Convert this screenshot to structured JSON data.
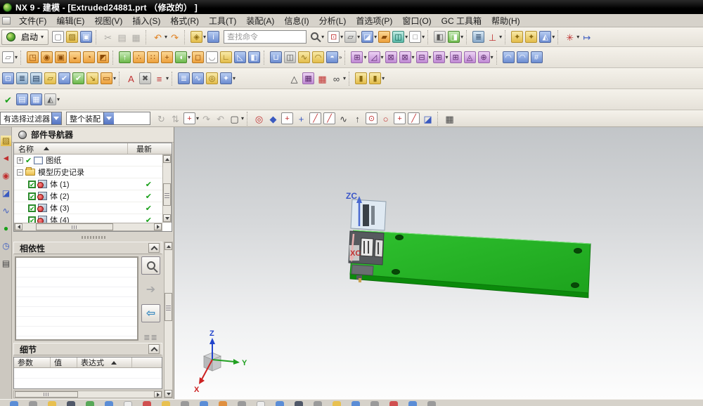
{
  "window": {
    "title": "NX 9 - 建模 - [Extruded24881.prt （修改的） ]"
  },
  "menu": {
    "items": [
      {
        "label": "文件(F)"
      },
      {
        "label": "编辑(E)"
      },
      {
        "label": "视图(V)"
      },
      {
        "label": "插入(S)"
      },
      {
        "label": "格式(R)"
      },
      {
        "label": "工具(T)"
      },
      {
        "label": "装配(A)"
      },
      {
        "label": "信息(I)"
      },
      {
        "label": "分析(L)"
      },
      {
        "label": "首选项(P)"
      },
      {
        "label": "窗口(O)"
      },
      {
        "label": "GC 工具箱"
      },
      {
        "label": "帮助(H)"
      }
    ]
  },
  "toolbars": {
    "launch_label": "启动",
    "launch_dd": "▾",
    "find_placeholder": "查找命令",
    "find_dd": "▾",
    "row1a": [
      {
        "n": "new-file-icon",
        "g": "▢",
        "cls": "c-white"
      },
      {
        "n": "open-file-icon",
        "g": "▨",
        "cls": "c-gold"
      },
      {
        "n": "save-icon",
        "g": "▣",
        "cls": "c-blue"
      },
      {
        "n": "separator",
        "cls": "tsep",
        "ia": "false"
      },
      {
        "n": "cut-icon",
        "g": "✂",
        "cls": "c-plain dim"
      },
      {
        "n": "copy-icon",
        "g": "▤",
        "cls": "c-plain dim"
      },
      {
        "n": "paste-icon",
        "g": "▦",
        "cls": "c-plain dim"
      },
      {
        "n": "separator",
        "cls": "tsep",
        "ia": "false"
      },
      {
        "n": "undo-icon",
        "g": "↶",
        "cls": "c-plain c-or-tx",
        "dd": "▾"
      },
      {
        "n": "redo-icon",
        "g": "↷",
        "cls": "c-plain c-or-tx"
      },
      {
        "n": "separator",
        "cls": "tsep",
        "ia": "false"
      },
      {
        "n": "command-key-icon",
        "g": "◈",
        "cls": "c-gold",
        "dd": "▾"
      },
      {
        "n": "info-tag-icon",
        "g": "i",
        "cls": "c-blue"
      }
    ],
    "row1b": [
      {
        "n": "fit-view-icon",
        "g": "⊡",
        "cls": "boxed c-bluetx",
        "dd": "▾"
      },
      {
        "n": "display-mode-icon",
        "g": "▱",
        "cls": "c-gray",
        "dd": "▾"
      },
      {
        "n": "shaded-view-icon",
        "g": "◪",
        "cls": "c-blue",
        "dd": "▾"
      },
      {
        "n": "render-style-icon",
        "g": "▰",
        "cls": "c-orange"
      },
      {
        "n": "translucency-icon",
        "g": "◫",
        "cls": "c-teal",
        "dd": "▾"
      },
      {
        "n": "background-icon",
        "g": "□",
        "cls": "c-white",
        "dd": "▾"
      },
      {
        "n": "separator",
        "cls": "tsep",
        "ia": "false"
      },
      {
        "n": "window-prev-icon",
        "g": "◧",
        "cls": "c-gray"
      },
      {
        "n": "window-next-icon",
        "g": "◨",
        "cls": "c-green2",
        "dd": "▾"
      },
      {
        "n": "separator",
        "cls": "tsep",
        "ia": "false"
      },
      {
        "n": "operation-list-icon",
        "g": "≣",
        "cls": "c-teal2"
      },
      {
        "n": "csys-orient-icon",
        "g": "⊥",
        "cls": "c-plain c-redax",
        "dd": "▾"
      },
      {
        "n": "separator",
        "cls": "tsep",
        "ia": "false"
      },
      {
        "n": "unlock-icon",
        "g": "✦",
        "cls": "c-gold"
      },
      {
        "n": "keys-icon",
        "g": "✦",
        "cls": "c-gold"
      },
      {
        "n": "visibility-toggle-icon",
        "g": "◭",
        "cls": "c-blue",
        "dd": "▾"
      },
      {
        "n": "separator",
        "cls": "tsep",
        "ia": "false"
      },
      {
        "n": "pins-icon",
        "g": "✳",
        "cls": "c-plain c-redax",
        "dd": "▾"
      },
      {
        "n": "measure-distance-icon",
        "g": "↦",
        "cls": "c-plain c-bluetx"
      }
    ],
    "row2": [
      {
        "n": "sketch-icon",
        "g": "▱",
        "cls": "c-white",
        "dd": "▾"
      },
      {
        "n": "separator",
        "cls": "tsep",
        "ia": "false"
      },
      {
        "n": "extrude-icon",
        "g": "◳",
        "cls": "c-orange"
      },
      {
        "n": "revolve-icon",
        "g": "◉",
        "cls": "c-orange"
      },
      {
        "n": "hole-icon",
        "g": "▣",
        "cls": "c-orange"
      },
      {
        "n": "boss-icon",
        "g": "◒",
        "cls": "c-orange"
      },
      {
        "n": "pocket-icon",
        "g": "◔",
        "cls": "c-orange"
      },
      {
        "n": "emboss-icon",
        "g": "◩",
        "cls": "c-orange"
      },
      {
        "n": "separator",
        "cls": "tsep",
        "ia": "false"
      },
      {
        "n": "datum-plane-icon",
        "g": "↑",
        "cls": "c-green2"
      },
      {
        "n": "cluster-icon",
        "g": "∴",
        "cls": "c-orange"
      },
      {
        "n": "pattern-feature-icon",
        "g": "∷",
        "cls": "c-orange"
      },
      {
        "n": "unite-icon",
        "g": "+",
        "cls": "c-orange"
      },
      {
        "n": "boolean-icon",
        "g": "◖",
        "cls": "c-green2",
        "dd": "▾"
      },
      {
        "n": "block-icon",
        "g": "◻",
        "cls": "c-orange"
      },
      {
        "n": "shell-icon",
        "g": "◡",
        "cls": "c-white"
      },
      {
        "n": "bracket-icon",
        "g": "∟",
        "cls": "c-gold"
      },
      {
        "n": "draft-icon",
        "g": "◺",
        "cls": "c-blue"
      },
      {
        "n": "chamfer-icon",
        "g": "◧",
        "cls": "c-blue"
      },
      {
        "n": "separator",
        "cls": "tsep",
        "ia": "false"
      },
      {
        "n": "blend-icon",
        "g": "⊔",
        "cls": "c-blue"
      },
      {
        "n": "trim-body-icon",
        "g": "◫",
        "cls": "c-gray"
      },
      {
        "n": "sheet-icon",
        "g": "∿",
        "cls": "c-gold"
      },
      {
        "n": "sweep-icon",
        "g": "◠",
        "cls": "c-gold"
      },
      {
        "n": "more-features-icon",
        "g": "◓",
        "cls": "c-blue",
        "dd": "»"
      },
      {
        "n": "separator",
        "cls": "tsep",
        "ia": "false"
      },
      {
        "n": "move-face-icon",
        "g": "⊞",
        "cls": "c-purple",
        "dd": "▾"
      },
      {
        "n": "delete-face-icon",
        "g": "◿",
        "cls": "c-purple",
        "dd": "▾"
      },
      {
        "n": "replace-face-icon",
        "g": "⊠",
        "cls": "c-purple"
      },
      {
        "n": "resize-face-icon",
        "g": "⊠",
        "cls": "c-purple",
        "dd": "▾"
      },
      {
        "n": "linear-dimension-icon",
        "g": "⊟",
        "cls": "c-purple",
        "dd": "▾"
      },
      {
        "n": "offset-face-icon",
        "g": "⊞",
        "cls": "c-purple",
        "dd": "▾"
      },
      {
        "n": "pattern-face-icon",
        "g": "⊞",
        "cls": "c-purple"
      },
      {
        "n": "make-coplanar-icon",
        "g": "◬",
        "cls": "c-purple"
      },
      {
        "n": "sync-modeling-icon",
        "g": "⊕",
        "cls": "c-purple",
        "dd": "▾"
      },
      {
        "n": "separator",
        "cls": "tsep",
        "ia": "false"
      },
      {
        "n": "four-point-surface-icon",
        "g": "◠",
        "cls": "c-blue"
      },
      {
        "n": "swept-surface-icon",
        "g": "◠",
        "cls": "c-blue"
      },
      {
        "n": "mesh-surface-icon",
        "g": "#",
        "cls": "c-blue"
      }
    ],
    "row3": [
      {
        "n": "view-frame-icon",
        "g": "⊡",
        "cls": "c-blue"
      },
      {
        "n": "layer-stack-icon",
        "g": "≣",
        "cls": "c-teal2"
      },
      {
        "n": "layer-settings-icon",
        "g": "▤",
        "cls": "c-teal2"
      },
      {
        "n": "tag-icon",
        "g": "▱",
        "cls": "c-gold"
      },
      {
        "n": "examine-geometry-icon",
        "g": "✔",
        "cls": "c-blue"
      },
      {
        "n": "fix-model-icon",
        "g": "✔",
        "cls": "c-green2"
      },
      {
        "n": "export-icon",
        "g": "↘",
        "cls": "c-gold"
      },
      {
        "n": "expression-icon",
        "g": "▭",
        "cls": "c-orange",
        "dd": "▾"
      },
      {
        "n": "separator",
        "cls": "tsep",
        "ia": "false"
      },
      {
        "n": "annotation-icon",
        "g": "A",
        "cls": "c-plain c-redax"
      },
      {
        "n": "mouse-gesture-icon",
        "g": "✖",
        "cls": "c-gray"
      },
      {
        "n": "ruler-hand-icon",
        "g": "≡",
        "cls": "c-plain c-redax",
        "dd": "▾"
      },
      {
        "n": "separator",
        "cls": "tsep",
        "ia": "false"
      },
      {
        "n": "database-icon",
        "g": "≣",
        "cls": "c-blue"
      },
      {
        "n": "spring-icon",
        "g": "∿",
        "cls": "c-blue"
      },
      {
        "n": "torus-icon",
        "g": "◎",
        "cls": "c-gold"
      },
      {
        "n": "hand-tool-icon",
        "g": "✦",
        "cls": "c-blue",
        "dd": "▾"
      },
      {
        "n": "spacer",
        "cls": "tspace",
        "ia": "false"
      },
      {
        "n": "triangle-icon",
        "g": "△",
        "cls": "c-plain"
      },
      {
        "n": "spreadsheet-icon",
        "g": "▦",
        "cls": "c-purple"
      },
      {
        "n": "table-add-icon",
        "g": "▦",
        "cls": "c-plain c-redax"
      },
      {
        "n": "circles-icon",
        "g": "∞",
        "cls": "c-plain",
        "dd": "▾"
      },
      {
        "n": "separator",
        "cls": "tsep",
        "ia": "false"
      },
      {
        "n": "assembly-box-icon",
        "g": "▮",
        "cls": "c-gold"
      },
      {
        "n": "assembly-boxes-icon",
        "g": "▮",
        "cls": "c-gold",
        "dd": "▾"
      }
    ],
    "row4": [
      {
        "n": "check-mate-icon",
        "g": "✔",
        "cls": "c-plain c-greentx"
      },
      {
        "n": "clipboard-icon",
        "g": "▤",
        "cls": "c-blue"
      },
      {
        "n": "table-icon",
        "g": "▦",
        "cls": "c-blue"
      },
      {
        "n": "view-section-icon",
        "g": "◭",
        "cls": "c-gray",
        "dd": "▾"
      }
    ]
  },
  "selection_bar": {
    "filter_value": "有选择过滤器",
    "scope_value": "整个装配",
    "icons": [
      {
        "n": "cycle-select-icon",
        "g": "↻",
        "cls": "c-plain dim"
      },
      {
        "n": "swap-select-icon",
        "g": "⇅",
        "cls": "c-plain dim"
      },
      {
        "n": "add-filter-icon",
        "g": "+",
        "cls": "boxed c-or-tx",
        "dd": "▾"
      },
      {
        "n": "rotate-cw-icon",
        "g": "↷",
        "cls": "c-plain dim"
      },
      {
        "n": "rotate-ccw-icon",
        "g": "↶",
        "cls": "c-plain dim"
      },
      {
        "n": "marquee-icon",
        "g": "▢",
        "cls": "c-plain",
        "dd": "▾"
      },
      {
        "n": "separator",
        "cls": "tsep",
        "ia": "false"
      },
      {
        "n": "highlight-icon",
        "g": "◎",
        "cls": "c-plain c-redax"
      },
      {
        "n": "shaded-select-icon",
        "g": "◆",
        "cls": "c-plain c-bluetx"
      },
      {
        "n": "snap-all-icon",
        "g": "+",
        "cls": "boxed c-or-tx"
      },
      {
        "n": "snap-point-icon",
        "g": "+",
        "cls": "c-plain c-bluetx"
      },
      {
        "n": "endpoint-snap-icon",
        "g": "╱",
        "cls": "boxed"
      },
      {
        "n": "midpoint-snap-icon",
        "g": "╱",
        "cls": "boxed"
      },
      {
        "n": "curve-snap-icon",
        "g": "∿",
        "cls": "c-plain"
      },
      {
        "n": "vertex-snap-icon",
        "g": "↑",
        "cls": "c-plain"
      },
      {
        "n": "center-snap-icon",
        "g": "⊙",
        "cls": "boxed"
      },
      {
        "n": "quadrant-snap-icon",
        "g": "○",
        "cls": "c-plain c-redax"
      },
      {
        "n": "intersection-snap-icon",
        "g": "+",
        "cls": "boxed"
      },
      {
        "n": "point-on-curve-icon",
        "g": "╱",
        "cls": "boxed"
      },
      {
        "n": "face-snap-icon",
        "g": "◪",
        "cls": "c-plain c-bluetx"
      },
      {
        "n": "separator",
        "cls": "tsep",
        "ia": "false"
      },
      {
        "n": "grid-snap-icon",
        "g": "▦",
        "cls": "c-plain"
      }
    ]
  },
  "resource_bar": {
    "tabs": [
      {
        "n": "assembly-navigator-icon",
        "g": "▨",
        "cls": "c-gold"
      },
      {
        "n": "constraint-navigator-icon",
        "g": "◄",
        "cls": "c-redax"
      },
      {
        "n": "part-navigator-icon",
        "g": "◉",
        "cls": "c-redax"
      },
      {
        "n": "reuse-library-icon",
        "g": "◪",
        "cls": "c-bluetx"
      },
      {
        "n": "hd3d-tools-icon",
        "g": "∿",
        "cls": "c-bluetx"
      },
      {
        "n": "web-browser-icon",
        "g": "●",
        "cls": "c-greentx"
      },
      {
        "n": "history-icon",
        "g": "◷",
        "cls": "c-bluetx"
      },
      {
        "n": "palettes-icon",
        "g": "▤",
        "cls": "c-plain"
      }
    ]
  },
  "part_navigator": {
    "title": "部件导航器",
    "col_name": "名称",
    "col_latest": "最新",
    "rows": [
      {
        "exp": "plus",
        "lead": "checkmark",
        "ic": "drawing",
        "label": "图纸",
        "latest": "",
        "ind": "i0"
      },
      {
        "exp": "minus",
        "lead": "none",
        "ic": "folder",
        "label": "模型历史记录",
        "latest": "",
        "ind": "i0"
      },
      {
        "exp": "none",
        "lead": "checkbox",
        "ic": "body",
        "label": "体 (1)",
        "latest": "✔",
        "ind": "i1"
      },
      {
        "exp": "none",
        "lead": "checkbox",
        "ic": "body",
        "label": "体 (2)",
        "latest": "✔",
        "ind": "i1"
      },
      {
        "exp": "none",
        "lead": "checkbox",
        "ic": "body",
        "label": "体 (3)",
        "latest": "✔",
        "ind": "i1"
      },
      {
        "exp": "none",
        "lead": "checkbox",
        "ic": "body",
        "label": "体 (4)",
        "latest": "✔",
        "ind": "i1"
      }
    ]
  },
  "dependencies": {
    "title": "相依性"
  },
  "details": {
    "title": "细节",
    "col_param": "参数",
    "col_value": "值",
    "col_expr": "表达式"
  },
  "viewport": {
    "zc_label": "ZC",
    "xc_label": "XC",
    "triad": {
      "x": "X",
      "y": "Y",
      "z": "Z"
    },
    "part_color": "#22b322",
    "part_edge_color": "#0c7a0c"
  },
  "taskbar": {
    "items": [
      {
        "n": "taskbar-icon",
        "cls": "tb-b"
      },
      {
        "n": "taskbar-icon",
        "cls": "tb-g"
      },
      {
        "n": "taskbar-icon",
        "cls": "tb-y"
      },
      {
        "n": "taskbar-icon",
        "cls": "tb-d"
      },
      {
        "n": "taskbar-icon",
        "cls": "tb-gr"
      },
      {
        "n": "taskbar-icon",
        "cls": "tb-b"
      },
      {
        "n": "taskbar-icon",
        "cls": "tb-w"
      },
      {
        "n": "taskbar-icon",
        "cls": "tb-r"
      },
      {
        "n": "taskbar-icon",
        "cls": "tb-y"
      },
      {
        "n": "taskbar-icon",
        "cls": "tb-g"
      },
      {
        "n": "taskbar-icon",
        "cls": "tb-b"
      },
      {
        "n": "taskbar-icon",
        "cls": "tb-o"
      },
      {
        "n": "taskbar-icon",
        "cls": "tb-g"
      },
      {
        "n": "taskbar-icon",
        "cls": "tb-w"
      },
      {
        "n": "taskbar-icon",
        "cls": "tb-b"
      },
      {
        "n": "taskbar-icon",
        "cls": "tb-d"
      },
      {
        "n": "taskbar-icon",
        "cls": "tb-g"
      },
      {
        "n": "taskbar-icon",
        "cls": "tb-y"
      },
      {
        "n": "taskbar-icon",
        "cls": "tb-b"
      },
      {
        "n": "taskbar-icon",
        "cls": "tb-g"
      },
      {
        "n": "taskbar-icon",
        "cls": "tb-r"
      },
      {
        "n": "taskbar-icon",
        "cls": "tb-b"
      },
      {
        "n": "taskbar-icon",
        "cls": "tb-g"
      }
    ]
  }
}
